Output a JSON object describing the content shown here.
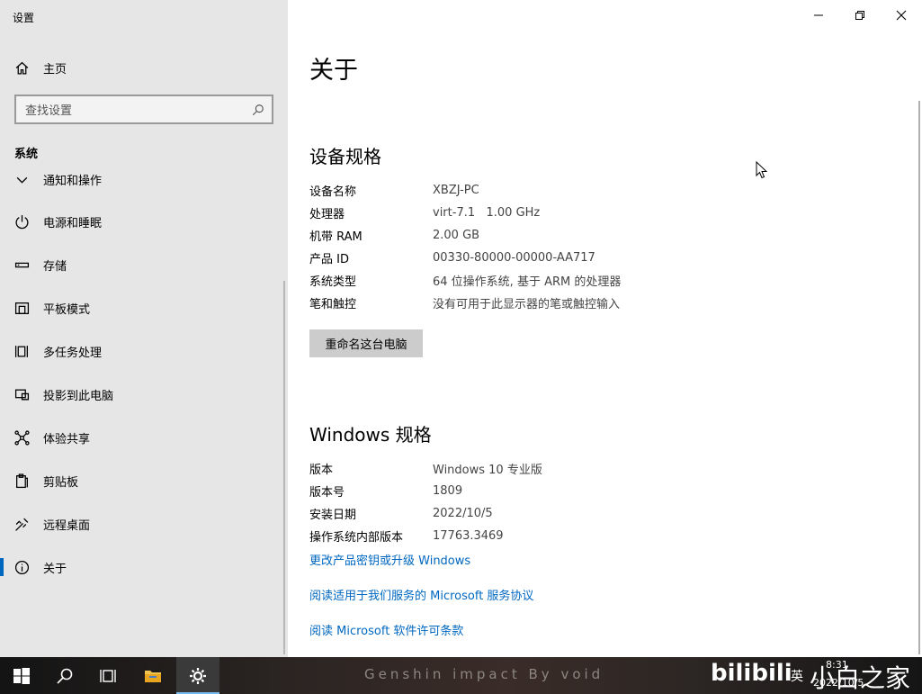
{
  "app": {
    "title": "设置"
  },
  "sidebar": {
    "home_label": "主页",
    "search_placeholder": "查找设置",
    "section": "系统",
    "partial_item": "通知和操作",
    "items": [
      {
        "label": "电源和睡眠",
        "icon": "power-icon"
      },
      {
        "label": "存储",
        "icon": "storage-icon"
      },
      {
        "label": "平板模式",
        "icon": "tablet-icon"
      },
      {
        "label": "多任务处理",
        "icon": "multitasking-icon"
      },
      {
        "label": "投影到此电脑",
        "icon": "project-icon"
      },
      {
        "label": "体验共享",
        "icon": "share-icon"
      },
      {
        "label": "剪贴板",
        "icon": "clipboard-icon"
      },
      {
        "label": "远程桌面",
        "icon": "remote-desktop-icon"
      },
      {
        "label": "关于",
        "icon": "info-icon",
        "selected": true
      }
    ]
  },
  "main": {
    "title": "关于",
    "device_heading": "设备规格",
    "device_specs": [
      {
        "key": "设备名称",
        "value": "XBZJ-PC"
      },
      {
        "key": "处理器",
        "value": "virt-7.1   1.00 GHz"
      },
      {
        "key": "机带 RAM",
        "value": "2.00 GB"
      },
      {
        "key": "产品 ID",
        "value": "00330-80000-00000-AA717"
      },
      {
        "key": "系统类型",
        "value": "64 位操作系统, 基于 ARM 的处理器"
      },
      {
        "key": "笔和触控",
        "value": "没有可用于此显示器的笔或触控输入"
      }
    ],
    "rename_button": "重命名这台电脑",
    "windows_heading": "Windows 规格",
    "windows_specs": [
      {
        "key": "版本",
        "value": "Windows 10 专业版"
      },
      {
        "key": "版本号",
        "value": "1809"
      },
      {
        "key": "安装日期",
        "value": "2022/10/5"
      },
      {
        "key": "操作系统内部版本",
        "value": "17763.3469"
      }
    ],
    "links": [
      "更改产品密钥或升级 Windows",
      "阅读适用于我们服务的 Microsoft 服务协议",
      "阅读 Microsoft 软件许可条款"
    ]
  },
  "taskbar": {
    "wallpaper_text": "Genshin impact By void",
    "watermark": "bilibili",
    "brand": "小白之家",
    "ime": "英",
    "time": "8:31",
    "date": "2022/10/5"
  }
}
